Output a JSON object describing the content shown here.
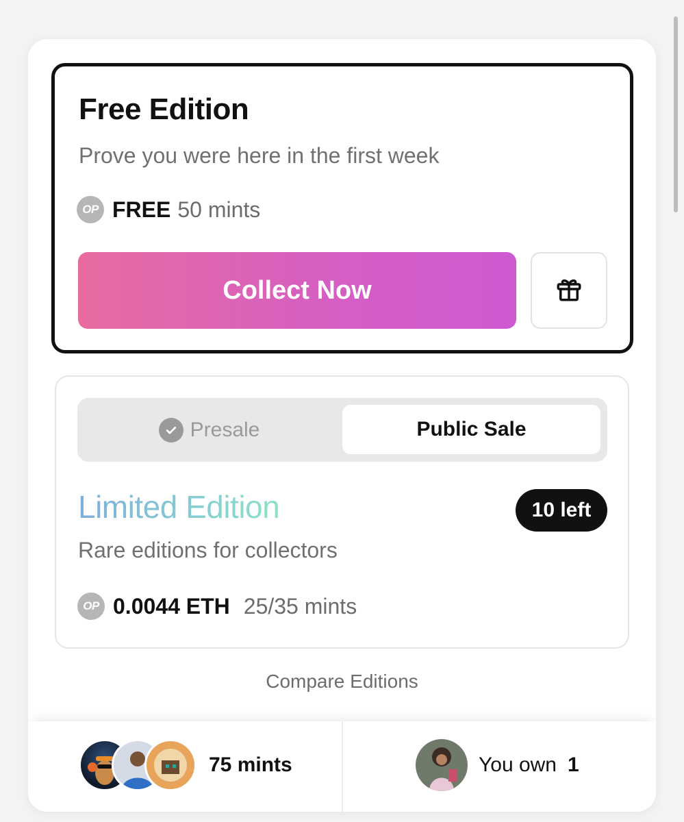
{
  "free_edition": {
    "title": "Free Edition",
    "subtitle": "Prove you were here in the first week",
    "network_badge": "OP",
    "price": "FREE",
    "mints": "50 mints",
    "collect_label": "Collect Now",
    "gift_icon": "gift-icon"
  },
  "limited_edition": {
    "tabs": {
      "presale": "Presale",
      "public_sale": "Public Sale",
      "active": "public_sale"
    },
    "title": "Limited Edition",
    "remaining": "10 left",
    "subtitle": "Rare editions for collectors",
    "network_badge": "OP",
    "price": "0.0044 ETH",
    "mints": "25/35 mints"
  },
  "compare_label": "Compare Editions",
  "footer": {
    "mints_count": "75 mints",
    "own_label": "You own",
    "own_count": "1"
  },
  "colors": {
    "collect_gradient_start": "#e86ba0",
    "collect_gradient_end": "#cd5ad3",
    "limited_gradient_start": "#7eaedc",
    "limited_gradient_end": "#8ee0c8",
    "pill_bg": "#111111"
  }
}
